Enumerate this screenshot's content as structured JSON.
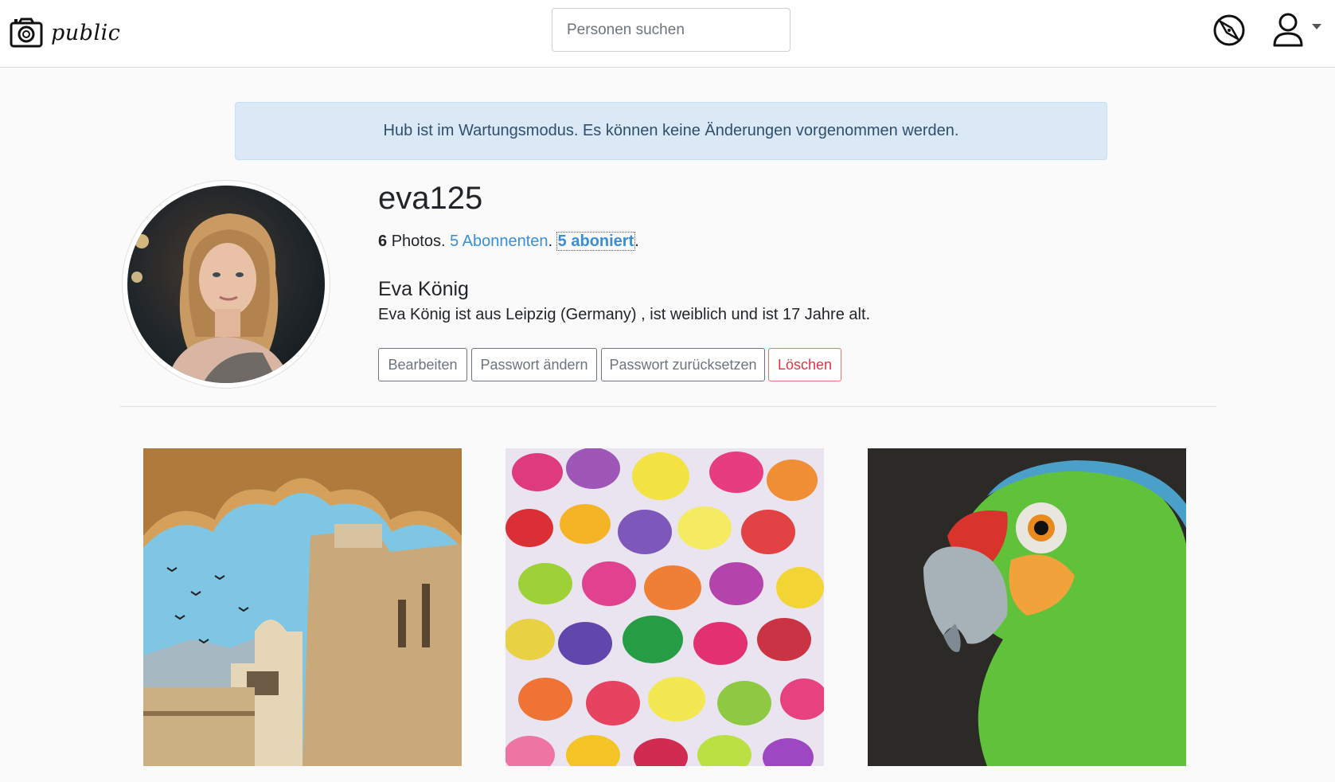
{
  "navbar": {
    "brand_name": "public",
    "brand_icon": "camera-icon",
    "search_placeholder": "Personen suchen",
    "explore_icon": "compass-icon",
    "profile_icon": "user-icon",
    "menu_icon": "caret-down-icon"
  },
  "alert": {
    "text": "Hub ist im Wartungsmodus. Es können keine Änderungen vorgenommen werden."
  },
  "profile": {
    "username": "eva125",
    "photos_count": "6",
    "photos_label": "Photos.",
    "followers_link": "5 Abonnenten",
    "following_link": "5 aboniert",
    "separator": ".",
    "full_name": "Eva König",
    "bio": "Eva König ist aus Leipzig (Germany) , ist weiblich und ist 17 Jahre alt.",
    "buttons": {
      "edit": "Bearbeiten",
      "change_password": "Passwort ändern",
      "reset_password": "Passwort zurücksetzen",
      "delete": "Löschen"
    }
  },
  "colors": {
    "link": "#3a8ed6",
    "alert_bg": "#dbe9f6",
    "danger": "#dc3545",
    "secondary": "#6c757d"
  },
  "photos": [
    {
      "subject": "palace-arch-birds"
    },
    {
      "subject": "colorful-candies"
    },
    {
      "subject": "green-parrot"
    }
  ]
}
